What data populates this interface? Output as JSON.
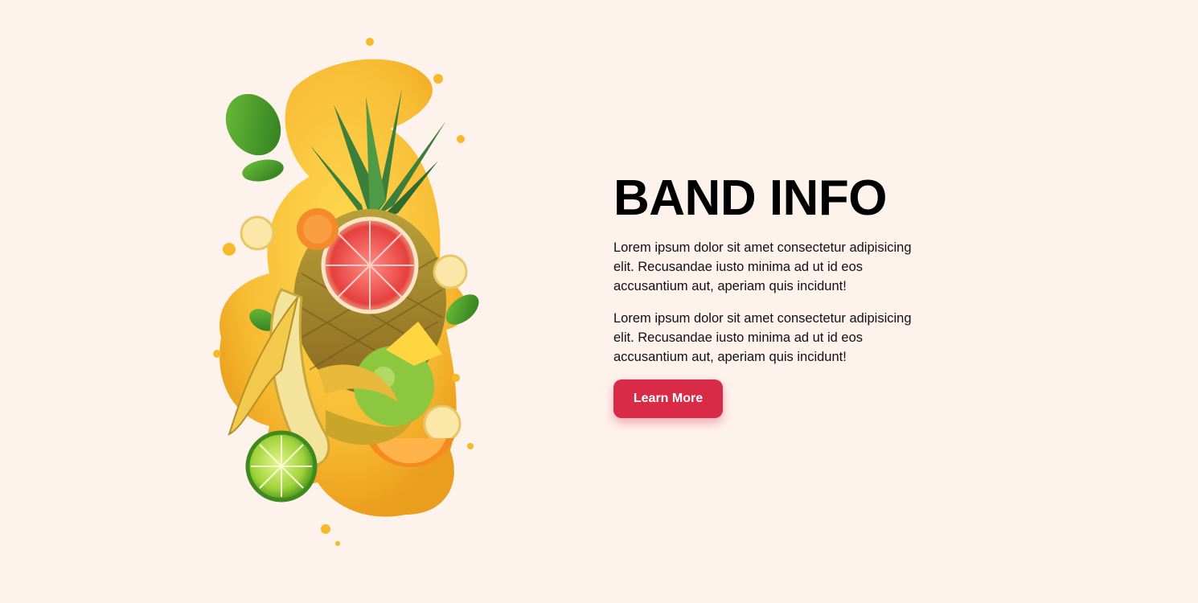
{
  "hero": {
    "illustration_icon": "fruit-splash-illustration"
  },
  "content": {
    "title": "BAND INFO",
    "paragraphs": [
      "Lorem ipsum dolor sit amet consectetur adipisicing elit. Recusandae iusto minima ad ut id eos accusantium aut, aperiam quis incidunt!",
      "Lorem ipsum dolor sit amet consectetur adipisicing elit. Recusandae iusto minima ad ut id eos accusantium aut, aperiam quis incidunt!"
    ],
    "button_label": "Learn More"
  },
  "colors": {
    "background": "#fef2ec",
    "button": "#d92a48",
    "juice": "#f7b82a",
    "leaf": "#3f8f2a"
  }
}
